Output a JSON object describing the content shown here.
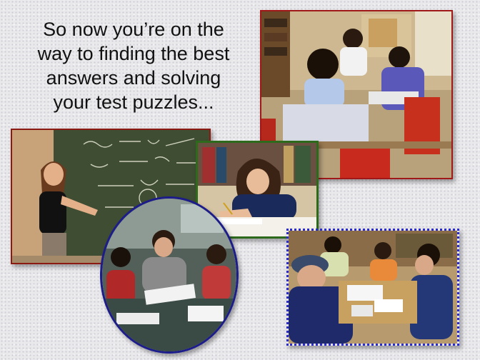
{
  "slide": {
    "headline_lines": [
      "So now you’re on the",
      "way to finding the best",
      "answers and solving",
      "your test puzzles..."
    ]
  },
  "photos": [
    {
      "name": "students-classroom-photo",
      "frame_color": "#a01818"
    },
    {
      "name": "blackboard-math-photo",
      "frame_color": "#8a1a12"
    },
    {
      "name": "student-writing-photo",
      "frame_color": "#2d6a1c"
    },
    {
      "name": "group-study-oval-photo",
      "frame_color": "#1c1c8a"
    },
    {
      "name": "library-study-photo",
      "frame_color": "#2a2ad0"
    }
  ]
}
